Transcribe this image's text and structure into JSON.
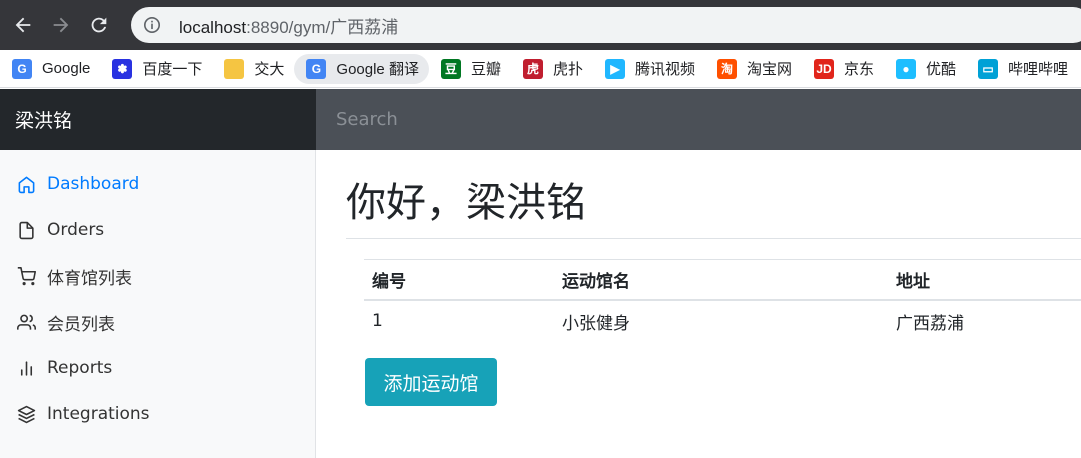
{
  "browser": {
    "url_host": "localhost",
    "url_rest": ":8890/gym/广西荔浦"
  },
  "bookmarks": [
    {
      "label": "Google",
      "icon": "google-icon",
      "color": "#4285f4",
      "glyph": "G"
    },
    {
      "label": "百度一下",
      "icon": "baidu-icon",
      "color": "#2932e1",
      "glyph": "✽"
    },
    {
      "label": "交大",
      "icon": "folder-icon",
      "color": "#f5c542",
      "glyph": ""
    },
    {
      "label": "Google 翻译",
      "icon": "google-translate-icon",
      "color": "#4285f4",
      "glyph": "G"
    },
    {
      "label": "豆瓣",
      "icon": "douban-icon",
      "color": "#007722",
      "glyph": "豆"
    },
    {
      "label": "虎扑",
      "icon": "hupu-icon",
      "color": "#c01e2f",
      "glyph": "虎"
    },
    {
      "label": "腾讯视频",
      "icon": "tencent-video-icon",
      "color": "#20b7ff",
      "glyph": "▶"
    },
    {
      "label": "淘宝网",
      "icon": "taobao-icon",
      "color": "#ff5000",
      "glyph": "淘"
    },
    {
      "label": "京东",
      "icon": "jd-icon",
      "color": "#e1251b",
      "glyph": "JD"
    },
    {
      "label": "优酷",
      "icon": "youku-icon",
      "color": "#1ebeff",
      "glyph": "●"
    },
    {
      "label": "哔哩哔哩",
      "icon": "bilibili-icon",
      "color": "#00a1d6",
      "glyph": "▭"
    }
  ],
  "navbar": {
    "brand": "梁洪铭",
    "search_placeholder": "Search"
  },
  "sidebar": {
    "items": [
      {
        "label": "Dashboard",
        "icon": "home-icon",
        "active": true
      },
      {
        "label": "Orders",
        "icon": "file-icon",
        "active": false
      },
      {
        "label": "体育馆列表",
        "icon": "shopping-cart-icon",
        "active": false
      },
      {
        "label": "会员列表",
        "icon": "users-icon",
        "active": false
      },
      {
        "label": "Reports",
        "icon": "bar-chart-icon",
        "active": false
      },
      {
        "label": "Integrations",
        "icon": "layers-icon",
        "active": false
      }
    ]
  },
  "main": {
    "greeting": "你好，梁洪铭",
    "table": {
      "headers": [
        "编号",
        "运动馆名",
        "地址"
      ],
      "rows": [
        [
          "1",
          "小张健身",
          "广西荔浦"
        ]
      ]
    },
    "add_button": "添加运动馆"
  },
  "colors": {
    "accent": "#007bff",
    "button": "#17a2b8",
    "navbar": "#343a40"
  }
}
